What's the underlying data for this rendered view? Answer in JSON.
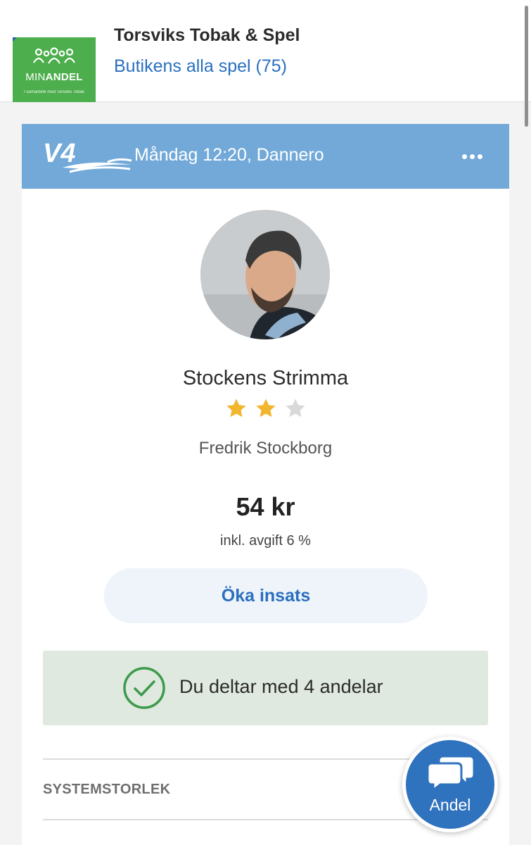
{
  "header": {
    "logo": {
      "brand_light": "MIN",
      "brand_bold": "ANDEL",
      "tagline": "I samarbete med Torsviks Tobak"
    },
    "shop_name": "Torsviks Tobak & Spel",
    "shop_games_link": "Butikens alla spel (75)"
  },
  "card": {
    "game_logo": "V4",
    "title": "Måndag 12:20, Dannero",
    "more_icon": "more-dots-icon",
    "game_name": "Stockens Strimma",
    "rating": {
      "value": 2,
      "max": 3
    },
    "author": "Fredrik Stockborg",
    "price": "54 kr",
    "fee_note": "inkl. avgift 6 %",
    "increase_button": "Öka insats",
    "participation": "Du deltar med 4 andelar",
    "section_label": "SYSTEMSTORLEK"
  },
  "fab": {
    "label": "Andel",
    "icon": "chat-bubbles-icon"
  },
  "colors": {
    "header_bar": "#72a9d8",
    "link": "#2a6fbf",
    "logo_green": "#4cae4c",
    "star_filled": "#f2b62e",
    "star_empty": "#d9d9d9",
    "success": "#3d9a4a",
    "success_bg": "#dfe9df",
    "fab": "#2f72bd"
  }
}
